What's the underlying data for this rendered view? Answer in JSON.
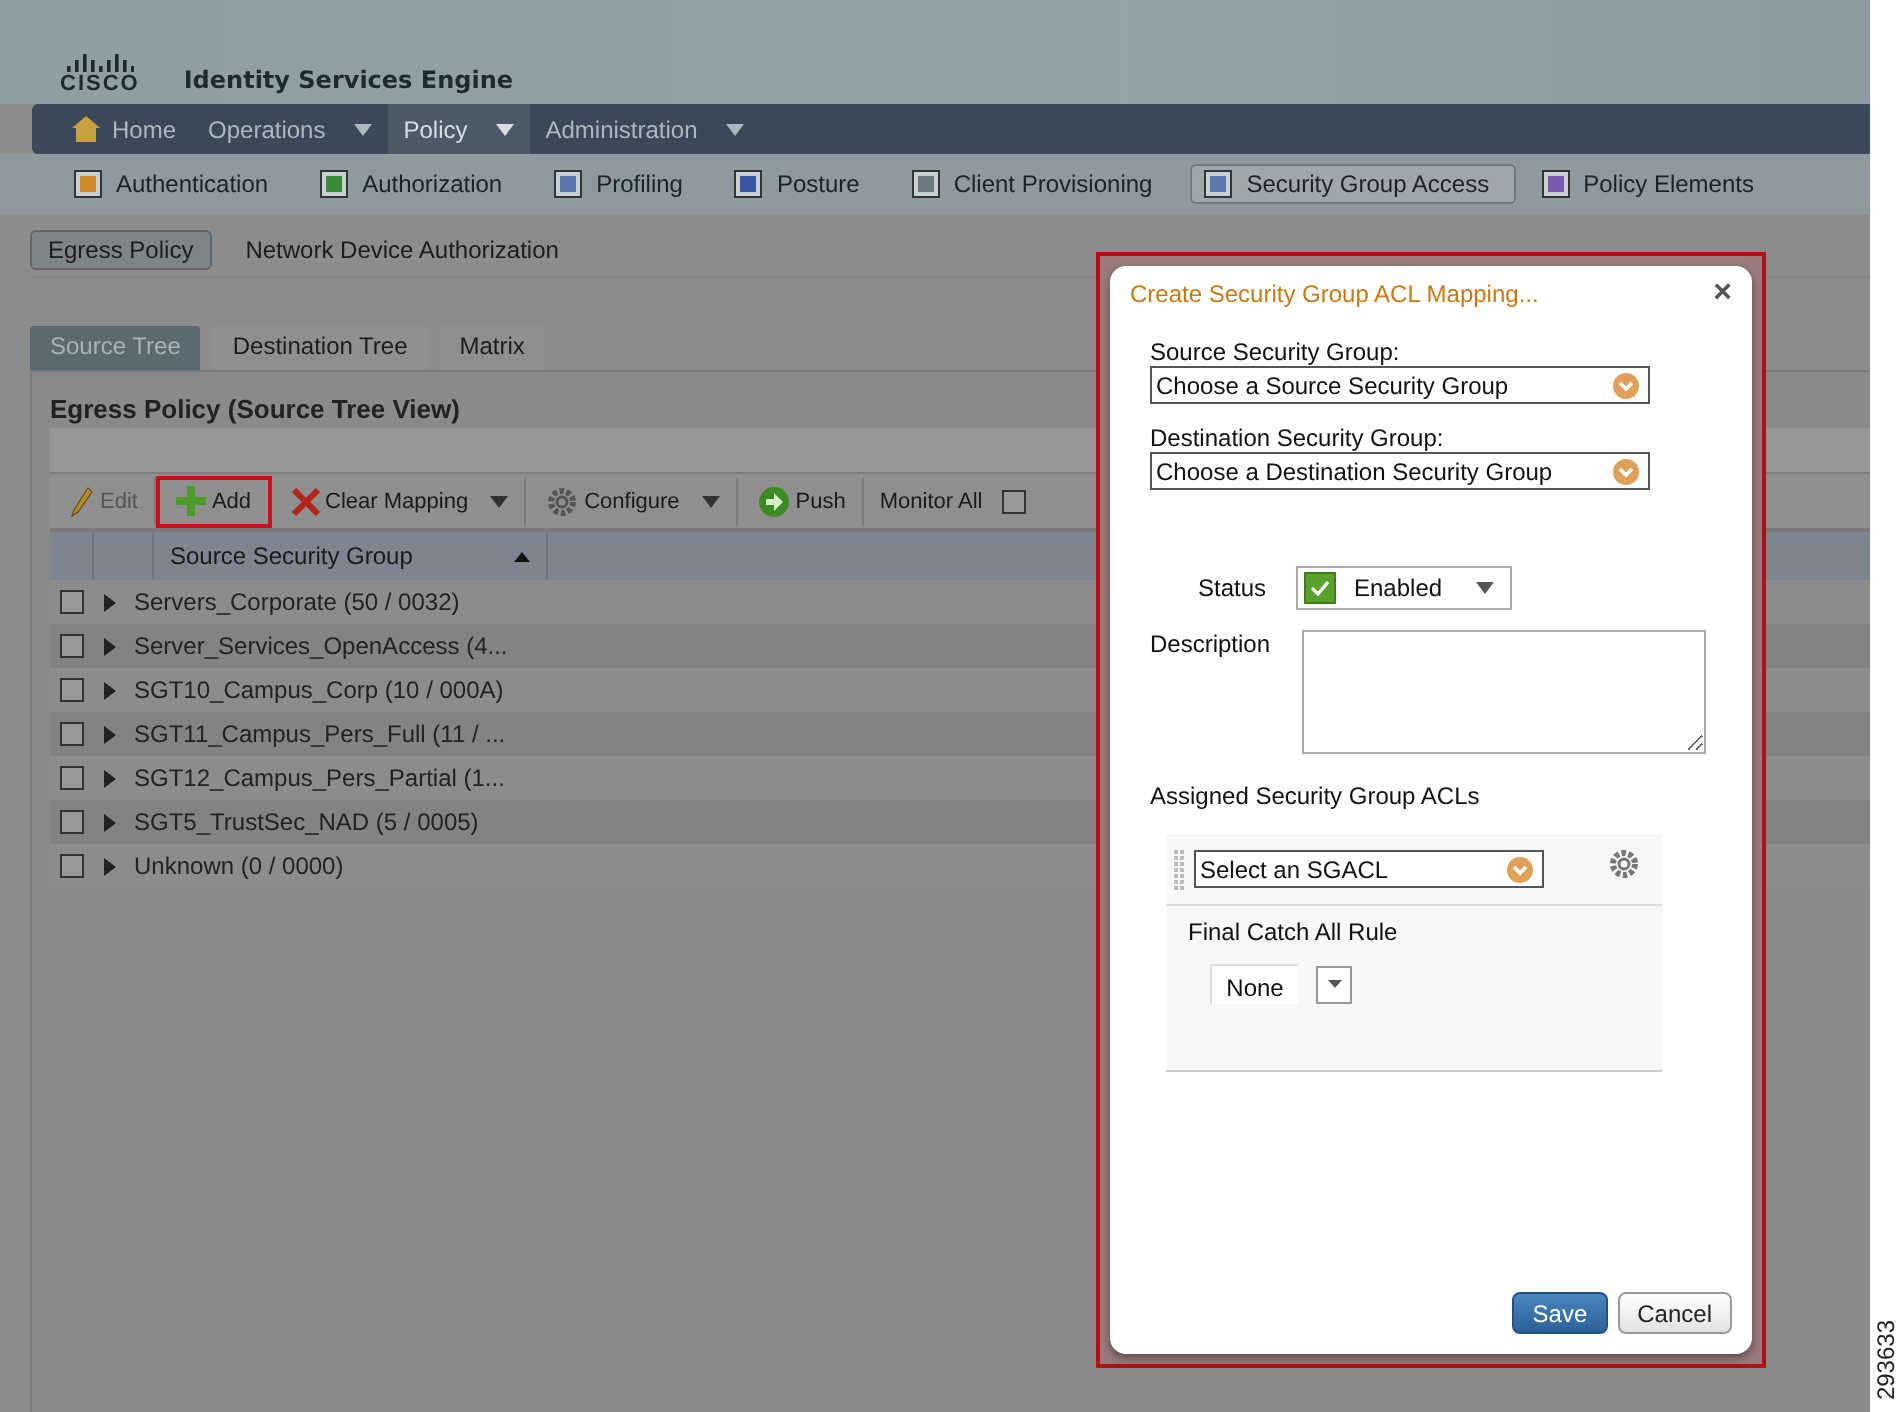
{
  "header": {
    "logo_text": "CISCO",
    "product": "Identity Services Engine"
  },
  "main_menu": [
    {
      "label": "Home",
      "kind": "home",
      "dropdown": false,
      "selected": false
    },
    {
      "label": "Operations",
      "kind": "plain",
      "dropdown": true,
      "selected": false
    },
    {
      "label": "Policy",
      "kind": "plain",
      "dropdown": true,
      "selected": true
    },
    {
      "label": "Administration",
      "kind": "plain",
      "dropdown": true,
      "selected": false
    }
  ],
  "sub_menu": [
    {
      "label": "Authentication",
      "selected": false
    },
    {
      "label": "Authorization",
      "selected": false
    },
    {
      "label": "Profiling",
      "selected": false
    },
    {
      "label": "Posture",
      "selected": false
    },
    {
      "label": "Client Provisioning",
      "selected": false
    },
    {
      "label": "Security Group Access",
      "selected": true
    },
    {
      "label": "Policy Elements",
      "selected": false
    }
  ],
  "page_tabs": [
    {
      "label": "Egress Policy",
      "selected": true
    },
    {
      "label": "Network Device Authorization",
      "selected": false
    }
  ],
  "view_tabs": [
    {
      "label": "Source Tree",
      "selected": true
    },
    {
      "label": "Destination Tree",
      "selected": false
    },
    {
      "label": "Matrix",
      "selected": false
    }
  ],
  "panel": {
    "title": "Egress Policy (Source Tree View)",
    "toolbar": [
      {
        "kind": "edit",
        "label": "Edit",
        "disabled": true,
        "highlighted": false,
        "dropdown": false
      },
      {
        "kind": "add",
        "label": "Add",
        "disabled": false,
        "highlighted": true,
        "dropdown": false
      },
      {
        "kind": "clear",
        "label": "Clear Mapping",
        "disabled": false,
        "highlighted": false,
        "dropdown": true
      },
      {
        "kind": "configure",
        "label": "Configure",
        "disabled": false,
        "highlighted": false,
        "dropdown": true
      },
      {
        "kind": "push",
        "label": "Push",
        "disabled": false,
        "highlighted": false,
        "dropdown": false
      }
    ],
    "monitor_all": {
      "label": "Monitor All",
      "checked": false
    },
    "column": "Source Security Group",
    "rows": [
      {
        "label": "Servers_Corporate (50 / 0032)",
        "checked": false
      },
      {
        "label": "Server_Services_OpenAccess (4...",
        "checked": false
      },
      {
        "label": "SGT10_Campus_Corp (10 / 000A)",
        "checked": false
      },
      {
        "label": "SGT11_Campus_Pers_Full (11 / ...",
        "checked": false
      },
      {
        "label": "SGT12_Campus_Pers_Partial (1...",
        "checked": false
      },
      {
        "label": "SGT5_TrustSec_NAD (5 / 0005)",
        "checked": false
      },
      {
        "label": "Unknown (0 / 0000)",
        "checked": false
      }
    ]
  },
  "dialog": {
    "title": "Create Security Group ACL Mapping...",
    "close": "×",
    "source_label": "Source Security Group:",
    "source_value": "Choose a Source Security Group",
    "destination_label": "Destination Security Group:",
    "destination_value": "Choose a Destination Security Group",
    "status_label": "Status",
    "status_value": "Enabled",
    "status_enabled": true,
    "description_label": "Description",
    "acl_label": "Assigned Security Group ACLs",
    "acl_value": "Select an SGACL",
    "catch_all_label": "Final Catch All Rule",
    "catch_all_value": "None",
    "buttons": [
      {
        "label": "Save",
        "primary": true
      },
      {
        "label": "Cancel",
        "primary": false
      }
    ]
  },
  "figure_number": "293633"
}
